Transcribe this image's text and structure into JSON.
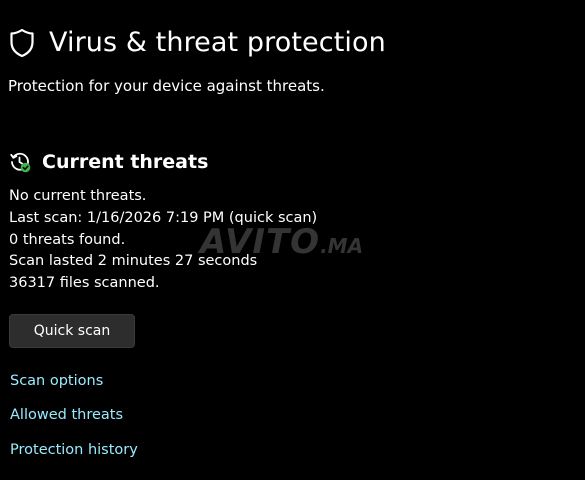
{
  "header": {
    "title": "Virus & threat protection",
    "subtitle": "Protection for your device against threats."
  },
  "current_threats": {
    "title": "Current threats",
    "status_lines": [
      "No current threats.",
      "Last scan: 1/16/2026 7:19 PM (quick scan)",
      "0 threats found.",
      "Scan lasted 2 minutes 27 seconds",
      "36317 files scanned."
    ],
    "quick_scan_label": "Quick scan"
  },
  "links": {
    "scan_options": "Scan options",
    "allowed_threats": "Allowed threats",
    "protection_history": "Protection history"
  },
  "watermark": {
    "main": "AVITO",
    "suffix": ".MA"
  },
  "icons": {
    "header": "shield-icon",
    "section": "clock-check-icon"
  },
  "colors": {
    "background": "#000000",
    "text": "#ffffff",
    "link": "#99ebff",
    "button_bg": "#2d2d2d",
    "check_green": "#3cb44b"
  }
}
